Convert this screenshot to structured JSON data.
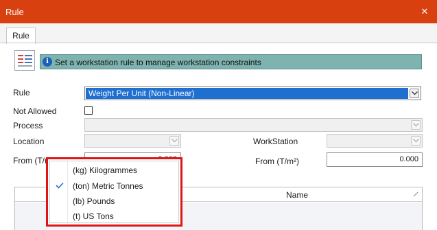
{
  "window": {
    "title": "Rule",
    "close_glyph": "✕"
  },
  "tabs": [
    {
      "label": "Rule"
    }
  ],
  "info": {
    "icon": "rules-list-icon",
    "text": "Set a workstation rule to manage workstation constraints",
    "accent": "#7fb3b0"
  },
  "form": {
    "rule_label": "Rule",
    "rule_value": "Weight Per Unit (Non-Linear)",
    "not_allowed_label": "Not Allowed",
    "not_allowed_checked": false,
    "process_label": "Process",
    "location_label": "Location",
    "workstation_label": "WorkStation",
    "from_left_label": "From (T/m²)",
    "from_left_value": "0.000",
    "from_right_label": "From (T/m²)",
    "from_right_value": "0.000"
  },
  "grid": {
    "columns": [
      {
        "label": "Name"
      }
    ]
  },
  "dropdown": {
    "options": [
      {
        "label": "(kg) Kilogrammes",
        "selected": false
      },
      {
        "label": "(ton) Metric Tonnes",
        "selected": true
      },
      {
        "label": "(lb) Pounds",
        "selected": false
      },
      {
        "label": "(t) US Tons",
        "selected": false
      }
    ]
  },
  "colors": {
    "titlebar": "#d9400f",
    "highlight": "#e01414",
    "selection": "#1e6fd0"
  }
}
